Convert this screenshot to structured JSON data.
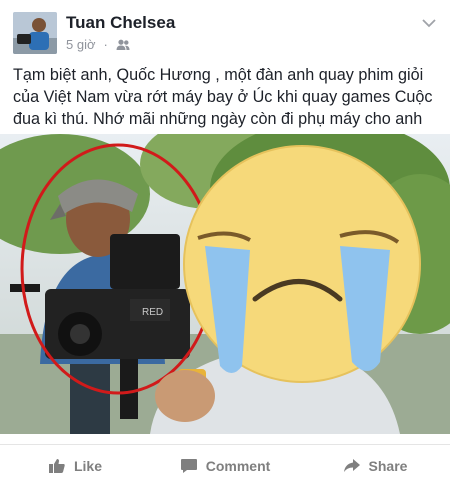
{
  "post": {
    "author": "Tuan Chelsea",
    "time": "5 giờ",
    "audience_icon": "friends-icon",
    "text": "Tạm biệt anh, Quốc Hương , một đàn anh quay phim giỏi của Việt Nam vừa rớt máy bay ở Úc khi quay games Cuộc đua kì thú. Nhớ mãi những ngày còn đi phụ máy cho anh",
    "photo": {
      "camera_brand": "RED",
      "highlight_color": "#d11a1a",
      "emoji_color": "#f6d97a",
      "tear_color": "#8fc3ee"
    }
  },
  "actions": {
    "like": "Like",
    "comment": "Comment",
    "share": "Share"
  },
  "colors": {
    "text": "#1d2129",
    "meta": "#90949c",
    "action": "#7f7f7f"
  }
}
